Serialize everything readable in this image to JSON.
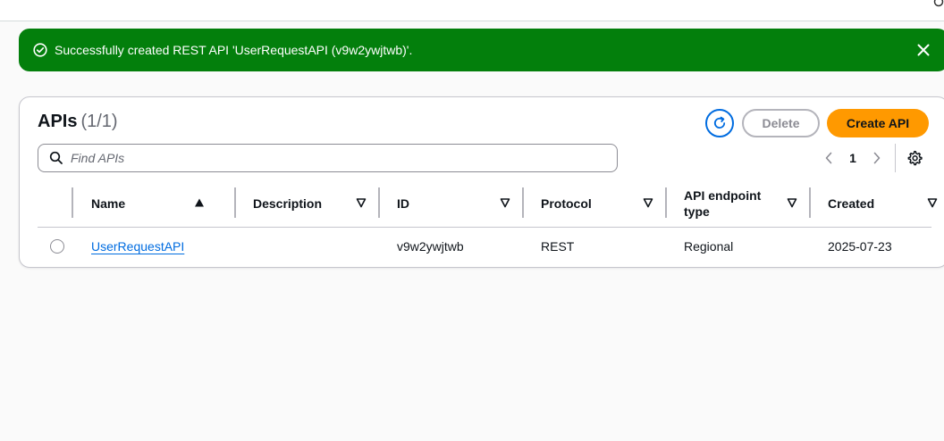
{
  "flash": {
    "message": "Successfully created REST API 'UserRequestAPI (v9w2ywjtwb)'.",
    "icon": "check-circle-icon",
    "close_icon": "close-icon",
    "color": "#037f0c"
  },
  "panel": {
    "title": "APIs",
    "count": "(1/1)",
    "refresh_icon": "refresh-icon",
    "delete_label": "Delete",
    "create_label": "Create API",
    "accent": "#ff9900"
  },
  "search": {
    "placeholder": "Find APIs",
    "value": ""
  },
  "pagination": {
    "current_page": "1",
    "prev_icon": "chevron-left-icon",
    "next_icon": "chevron-right-icon",
    "settings_icon": "gear-icon"
  },
  "table": {
    "columns": [
      {
        "label": "Name",
        "sort": "ascending"
      },
      {
        "label": "Description",
        "sort": "none"
      },
      {
        "label": "ID",
        "sort": "none"
      },
      {
        "label": "Protocol",
        "sort": "none"
      },
      {
        "label": "API endpoint type",
        "sort": "none"
      },
      {
        "label": "Created",
        "sort": "none"
      }
    ],
    "rows": [
      {
        "name": "UserRequestAPI",
        "description": "",
        "id": "v9w2ywjtwb",
        "protocol": "REST",
        "endpoint_type": "Regional",
        "created": "2025-07-23",
        "selected": false
      }
    ]
  }
}
